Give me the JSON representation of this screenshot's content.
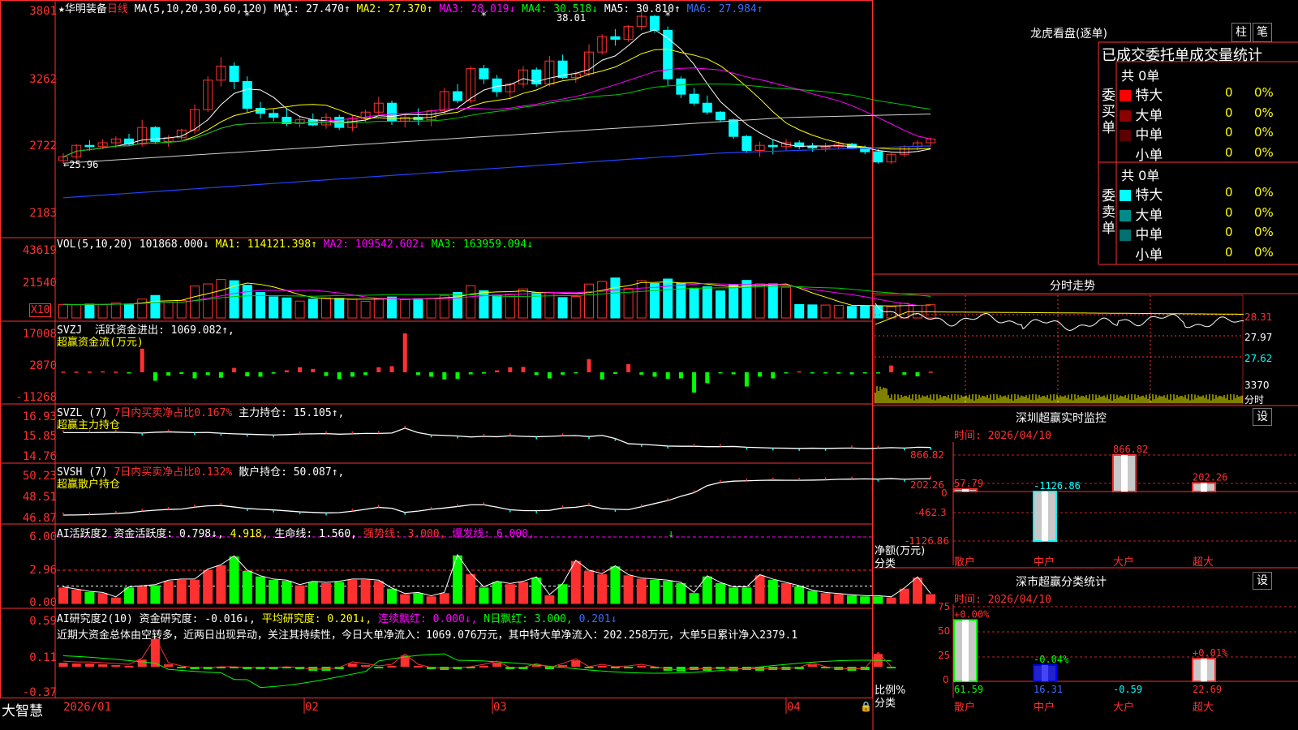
{
  "stock": {
    "name": "华明装备",
    "period": "日线",
    "star": "★"
  },
  "main": {
    "ma_line": "MA(5,10,20,30,60,120)",
    "ma1": "MA1: 27.470↑",
    "ma2": "MA2: 27.370↑",
    "ma3": "MA3: 28.019↓",
    "ma4": "MA4: 30.518↓",
    "ma5": "MA5: 30.810↑",
    "ma6": "MA6: 27.984↑",
    "high_mark": "38.01",
    "low_mark": "25.96",
    "yticks": [
      "3801",
      "3262",
      "2722",
      "2183"
    ]
  },
  "vol": {
    "label": "VOL(5,10,20)",
    "v": "101868.000↓",
    "ma1": "MA1: 114121.398↑",
    "ma2": "MA2: 109542.602↓",
    "ma3": "MA3: 163959.094↓",
    "unit": "X10",
    "yticks": [
      "43619",
      "21540"
    ]
  },
  "svzj": {
    "label": "SVZJ",
    "desc": "活跃资金进出: 1069.082↑,",
    "title": "超赢资金流(万元)",
    "yticks": [
      "17008",
      "2870",
      "-11268"
    ]
  },
  "svzl": {
    "label": "SVZL (7)",
    "desc": "7日内买卖净占比0.167%",
    "hold": "主力持仓: 15.105↑,",
    "title": "超赢主力持仓",
    "yticks": [
      "16.93",
      "15.85",
      "14.76"
    ]
  },
  "svsh": {
    "label": "SVSH (7)",
    "desc": "7日内买卖净占比0.132%",
    "hold": "散户持仓: 50.087↑,",
    "title": "超赢散户持仓",
    "yticks": [
      "50.23",
      "48.51",
      "46.87"
    ]
  },
  "ai1": {
    "label": "AI活跃度2",
    "act": "资金活跃度: 0.798↓,",
    "v2": "4.918,",
    "life": "生命线: 1.560,",
    "strong": "强势线: 3.000,",
    "burst": "爆发线: 6.000,",
    "yticks": [
      "6.00",
      "2.96",
      "0.00"
    ]
  },
  "ai2": {
    "label": "AI研究度2(10)",
    "r1": "资金研究度: -0.016↓,",
    "r2": "平均研究度: 0.201↓,",
    "r3": "连续飘红: 0.000↓,",
    "r4": "N日飘红: 3.000,",
    "r5": "0.201↓",
    "comment": "近期大资金总体由空转多，近两日出现异动，关注其持续性，今日大单净流入：1069.076万元，其中特大单净流入：202.258万元，大单5日累计净入2379.1",
    "yticks": [
      "0.59",
      "0.11",
      "-0.37"
    ]
  },
  "xaxis": {
    "brand": "大智慧",
    "labels": [
      "2026/01",
      "02",
      "03",
      "04"
    ]
  },
  "right": {
    "lh_title": "龙虎看盘(逐单)",
    "btn_zhu": "柱",
    "btn_bi": "笔",
    "stat_title": "已成交委托单成交量统计",
    "buy_label": "委买单",
    "sell_label": "委卖单",
    "buy_total": "共 0单",
    "sell_total": "共 0单",
    "buy_rows": [
      {
        "name": "特大",
        "v": "0",
        "p": "0%",
        "color": "#ff0000"
      },
      {
        "name": "大单",
        "v": "0",
        "p": "0%",
        "color": "#8b0000"
      },
      {
        "name": "中单",
        "v": "0",
        "p": "0%",
        "color": "#5a0000"
      },
      {
        "name": "小单",
        "v": "0",
        "p": "0%",
        "color": "#000000"
      }
    ],
    "sell_rows": [
      {
        "name": "特大",
        "v": "0",
        "p": "0%",
        "color": "#00ffff"
      },
      {
        "name": "大单",
        "v": "0",
        "p": "0%",
        "color": "#008b8b"
      },
      {
        "name": "中单",
        "v": "0",
        "p": "0%",
        "color": "#007070"
      },
      {
        "name": "小单",
        "v": "0",
        "p": "0%",
        "color": "#000000"
      }
    ],
    "fs_title": "分时走势",
    "fs_prices": [
      "28.31",
      "27.97",
      "27.62"
    ],
    "fs_vol": "3370",
    "fs_vol_label": "分时",
    "mon_title": "深圳超赢实时监控",
    "mon_btn": "设",
    "mon_time": "时间: 2026/04/10",
    "mon_yticks": [
      "866.82",
      "202.26",
      "0",
      "-462.3",
      "-1126.86"
    ],
    "mon_ylabel": "净额(万元)",
    "mon_xlabel": "分类",
    "cls_title": "深市超赢分类统计",
    "cls_btn": "设",
    "cls_time": "时间: 2026/04/10",
    "cls_yticks": [
      "75",
      "50",
      "25",
      "0"
    ],
    "cls_ylabel": "比例%",
    "cls_xlabel": "分类"
  },
  "chart_data": [
    {
      "type": "candlestick",
      "title": "华明装备 日线",
      "ylim": [
        21.83,
        38.01
      ],
      "x_labels": [
        "2026/01",
        "02",
        "03",
        "04"
      ],
      "ohlc": [
        [
          26.2,
          26.8,
          26.0,
          26.5
        ],
        [
          26.5,
          27.5,
          26.3,
          27.4
        ],
        [
          27.4,
          27.8,
          27.0,
          27.3
        ],
        [
          27.3,
          27.9,
          27.1,
          27.6
        ],
        [
          27.6,
          28.1,
          27.2,
          27.9
        ],
        [
          27.9,
          28.3,
          27.4,
          27.5
        ],
        [
          27.5,
          29.4,
          27.3,
          28.8
        ],
        [
          28.8,
          28.9,
          27.5,
          27.7
        ],
        [
          27.7,
          28.2,
          27.3,
          28.0
        ],
        [
          28.0,
          28.7,
          27.8,
          28.6
        ],
        [
          28.6,
          30.6,
          28.3,
          30.2
        ],
        [
          30.2,
          32.8,
          30.0,
          32.5
        ],
        [
          32.5,
          34.3,
          32.0,
          33.6
        ],
        [
          33.6,
          33.9,
          31.8,
          32.4
        ],
        [
          32.4,
          32.8,
          30.0,
          30.3
        ],
        [
          30.3,
          30.8,
          29.5,
          29.9
        ],
        [
          29.9,
          30.3,
          29.3,
          29.6
        ],
        [
          29.6,
          30.3,
          28.9,
          29.1
        ],
        [
          29.1,
          29.7,
          28.8,
          29.4
        ],
        [
          29.4,
          29.9,
          28.9,
          29.0
        ],
        [
          29.0,
          29.9,
          28.7,
          29.6
        ],
        [
          29.6,
          29.8,
          28.6,
          28.8
        ],
        [
          28.8,
          29.8,
          28.5,
          29.5
        ],
        [
          29.5,
          30.2,
          29.2,
          30.0
        ],
        [
          30.0,
          31.2,
          29.8,
          30.7
        ],
        [
          30.7,
          30.9,
          29.0,
          29.3
        ],
        [
          29.3,
          29.9,
          28.8,
          29.6
        ],
        [
          29.6,
          30.3,
          29.0,
          29.4
        ],
        [
          29.4,
          30.2,
          28.9,
          30.1
        ],
        [
          30.1,
          31.9,
          29.9,
          31.6
        ],
        [
          31.6,
          32.2,
          30.7,
          30.9
        ],
        [
          30.9,
          33.6,
          30.7,
          33.4
        ],
        [
          33.4,
          33.7,
          32.2,
          32.6
        ],
        [
          32.6,
          32.9,
          31.2,
          31.6
        ],
        [
          31.6,
          32.3,
          31.1,
          32.2
        ],
        [
          32.2,
          33.6,
          31.9,
          33.3
        ],
        [
          33.3,
          33.5,
          32.0,
          32.2
        ],
        [
          32.2,
          34.4,
          32.0,
          34.0
        ],
        [
          34.0,
          34.5,
          32.6,
          32.7
        ],
        [
          32.7,
          33.2,
          32.3,
          33.0
        ],
        [
          33.0,
          35.3,
          32.8,
          34.7
        ],
        [
          34.7,
          36.1,
          34.5,
          35.9
        ],
        [
          35.9,
          36.5,
          35.2,
          35.7
        ],
        [
          35.7,
          36.8,
          35.5,
          36.7
        ],
        [
          36.7,
          38.01,
          36.4,
          37.5
        ],
        [
          37.5,
          37.6,
          36.2,
          36.4
        ],
        [
          36.4,
          36.7,
          32.1,
          32.6
        ],
        [
          32.6,
          32.8,
          31.1,
          31.4
        ],
        [
          31.4,
          31.9,
          30.5,
          30.7
        ],
        [
          30.7,
          31.3,
          29.8,
          30.0
        ],
        [
          30.0,
          30.1,
          29.2,
          29.4
        ],
        [
          29.4,
          29.5,
          27.9,
          28.1
        ],
        [
          28.1,
          28.2,
          26.8,
          27.0
        ],
        [
          27.0,
          27.7,
          26.5,
          27.4
        ],
        [
          27.4,
          27.8,
          26.7,
          27.3
        ],
        [
          27.3,
          27.9,
          27.0,
          27.6
        ],
        [
          27.6,
          27.8,
          27.1,
          27.3
        ],
        [
          27.3,
          27.6,
          26.9,
          27.2
        ],
        [
          27.2,
          27.6,
          26.9,
          27.3
        ],
        [
          27.3,
          27.7,
          27.1,
          27.5
        ],
        [
          27.5,
          27.6,
          27.1,
          27.2
        ],
        [
          27.2,
          27.4,
          26.7,
          26.9
        ],
        [
          26.9,
          27.1,
          25.96,
          26.1
        ],
        [
          26.1,
          26.8,
          25.96,
          26.7
        ],
        [
          26.7,
          27.4,
          26.5,
          27.3
        ],
        [
          27.3,
          27.8,
          27.0,
          27.6
        ],
        [
          27.6,
          28.0,
          27.3,
          27.9
        ]
      ],
      "series": [
        {
          "name": "MA1",
          "last": 27.47
        },
        {
          "name": "MA2",
          "last": 27.37
        },
        {
          "name": "MA3",
          "last": 28.019
        },
        {
          "name": "MA4",
          "last": 30.518
        },
        {
          "name": "MA5",
          "last": 30.81
        },
        {
          "name": "MA6",
          "last": 27.984
        }
      ]
    },
    {
      "type": "bar",
      "title": "VOL(5,10,20)",
      "ylim": [
        0,
        48000
      ],
      "values": [
        8900,
        8700,
        9100,
        8800,
        9800,
        9200,
        12400,
        14800,
        10200,
        11500,
        21000,
        22400,
        25300,
        24500,
        21500,
        16800,
        13900,
        13200,
        11100,
        12400,
        13200,
        12900,
        12200,
        10900,
        12700,
        13800,
        12100,
        12700,
        12800,
        14800,
        16800,
        21200,
        17900,
        15100,
        15600,
        19100,
        16600,
        16900,
        13400,
        14100,
        22300,
        24000,
        26300,
        19400,
        24500,
        22700,
        25600,
        22800,
        19600,
        20500,
        17800,
        22000,
        24700,
        22400,
        22400,
        20200,
        8800,
        8600,
        8500,
        8300,
        7600,
        8000,
        7900,
        7400,
        9600,
        8300,
        8700
      ]
    },
    {
      "type": "bar",
      "title": "超赢资金流(万元)",
      "ylim": [
        -11268,
        17008
      ],
      "values": [
        200,
        200,
        200,
        300,
        200,
        -200,
        7000,
        -2500,
        -1000,
        -500,
        -1800,
        -800,
        -1600,
        1300,
        -1200,
        -1300,
        -400,
        600,
        1500,
        1000,
        -1100,
        -2000,
        -1300,
        -800,
        1500,
        1800,
        11500,
        -800,
        -1300,
        -2100,
        -1900,
        -600,
        -400,
        600,
        1500,
        1600,
        -800,
        -1800,
        -700,
        -300,
        3900,
        -2100,
        -500,
        2400,
        -700,
        -1300,
        -1900,
        -1800,
        -6000,
        -3200,
        -100,
        -600,
        -4200,
        -1300,
        -1800,
        -300,
        300,
        -200,
        -300,
        -400,
        -600,
        -300,
        -200,
        2000,
        -700,
        -1200,
        200,
        5600,
        -1200,
        -900
      ]
    },
    {
      "type": "line",
      "title": "超赢主力持仓",
      "ylim": [
        14.76,
        16.93
      ],
      "values": [
        16.12,
        16.12,
        16.12,
        16.13,
        16.14,
        16.12,
        16.1,
        16.14,
        16.16,
        16.14,
        16.12,
        16.13,
        16.09,
        16.06,
        16.04,
        16.02,
        16.0,
        16.02,
        16.05,
        16.06,
        16.07,
        16.04,
        16.06,
        16.08,
        16.08,
        16.1,
        16.35,
        16.12,
        16.0,
        15.98,
        15.95,
        15.9,
        15.93,
        15.91,
        15.96,
        15.93,
        15.91,
        15.93,
        15.96,
        15.97,
        15.92,
        15.98,
        15.82,
        15.55,
        15.52,
        15.48,
        15.43,
        15.42,
        15.42,
        15.4,
        15.4,
        15.41,
        15.37,
        15.35,
        15.33,
        15.32,
        15.31,
        15.32,
        15.31,
        15.32,
        15.33,
        15.3,
        15.32,
        15.35,
        15.33,
        15.37,
        15.36
      ]
    },
    {
      "type": "line",
      "title": "超赢散户持仓",
      "ylim": [
        46.87,
        50.23
      ],
      "values": [
        47.25,
        47.26,
        47.28,
        47.32,
        47.37,
        47.43,
        47.55,
        47.63,
        47.69,
        47.72,
        47.87,
        47.97,
        48.0,
        47.88,
        47.76,
        47.7,
        47.65,
        47.58,
        47.5,
        47.46,
        47.42,
        47.44,
        47.55,
        47.7,
        47.85,
        47.78,
        47.46,
        47.56,
        47.7,
        47.8,
        47.92,
        48.05,
        48.05,
        47.87,
        47.66,
        47.6,
        47.59,
        47.62,
        47.8,
        47.86,
        48.01,
        47.76,
        47.7,
        47.68,
        47.9,
        48.15,
        48.38,
        48.72,
        49.0,
        49.55,
        49.8,
        49.9,
        49.93,
        49.96,
        49.98,
        49.97,
        49.97,
        49.98,
        50.0,
        50.05,
        50.06,
        50.08,
        50.06,
        50.1,
        50.05,
        50.08,
        50.09
      ]
    },
    {
      "type": "bar",
      "title": "AI活跃度2",
      "ylim": [
        0,
        6
      ],
      "values": [
        1.4,
        1.2,
        1.0,
        0.9,
        0.5,
        1.4,
        1.5,
        1.6,
        2.0,
        2.1,
        2.1,
        3.0,
        3.4,
        4.2,
        2.9,
        2.4,
        2.1,
        2.0,
        1.6,
        1.9,
        1.8,
        1.9,
        2.1,
        2.1,
        2.0,
        1.3,
        0.8,
        0.9,
        0.6,
        0.9,
        4.3,
        2.6,
        1.4,
        1.9,
        1.7,
        1.9,
        2.3,
        0.7,
        1.7,
        3.8,
        2.9,
        2.6,
        3.3,
        2.5,
        2.2,
        2.1,
        2.0,
        1.8,
        0.9,
        2.4,
        1.8,
        1.4,
        1.4,
        2.5,
        2.1,
        1.8,
        1.5,
        1.1,
        0.9,
        0.8,
        0.7,
        0.6,
        0.6,
        0.5,
        1.3,
        2.3,
        0.8
      ]
    },
    {
      "type": "bar",
      "title": "AI研究度2(10)",
      "ylim": [
        -0.37,
        0.59
      ],
      "values": [
        0.05,
        0.04,
        0.04,
        0.03,
        0.02,
        0.01,
        0.09,
        0.35,
        0.03,
        -0.01,
        -0.03,
        -0.03,
        -0.02,
        -0.02,
        -0.03,
        -0.03,
        -0.03,
        -0.02,
        -0.03,
        -0.05,
        -0.05,
        -0.03,
        0.04,
        0.02,
        -0.01,
        0.01,
        0.14,
        0.01,
        -0.03,
        -0.04,
        -0.03,
        -0.02,
        0.01,
        0.05,
        -0.03,
        -0.03,
        0.02,
        -0.03,
        0.02,
        0.08,
        -0.02,
        0.01,
        -0.02,
        -0.01,
        0.01,
        -0.02,
        -0.05,
        -0.06,
        -0.04,
        -0.05,
        -0.03,
        -0.05,
        -0.04,
        -0.05,
        -0.04,
        -0.04,
        -0.03,
        0.03,
        -0.02,
        -0.04,
        -0.05,
        -0.04,
        0.16,
        -0.02
      ]
    },
    {
      "type": "bar",
      "title": "深圳超赢实时监控",
      "ylabel": "净额(万元)",
      "xlabel": "分类",
      "ylim": [
        -1126.86,
        866.82
      ],
      "categories": [
        "散户",
        "中户",
        "大户",
        "超大"
      ],
      "values": [
        57.79,
        -1126.86,
        866.82,
        202.26
      ]
    },
    {
      "type": "bar",
      "title": "深市超赢分类统计",
      "ylabel": "比例%",
      "xlabel": "分类",
      "ylim": [
        0,
        75
      ],
      "categories": [
        "散户",
        "中户",
        "大户",
        "超大"
      ],
      "values": [
        61.59,
        16.31,
        -0.59,
        22.69
      ],
      "changes": [
        "+0.00%",
        "-0.04%",
        "",
        "+0.01%"
      ]
    }
  ]
}
